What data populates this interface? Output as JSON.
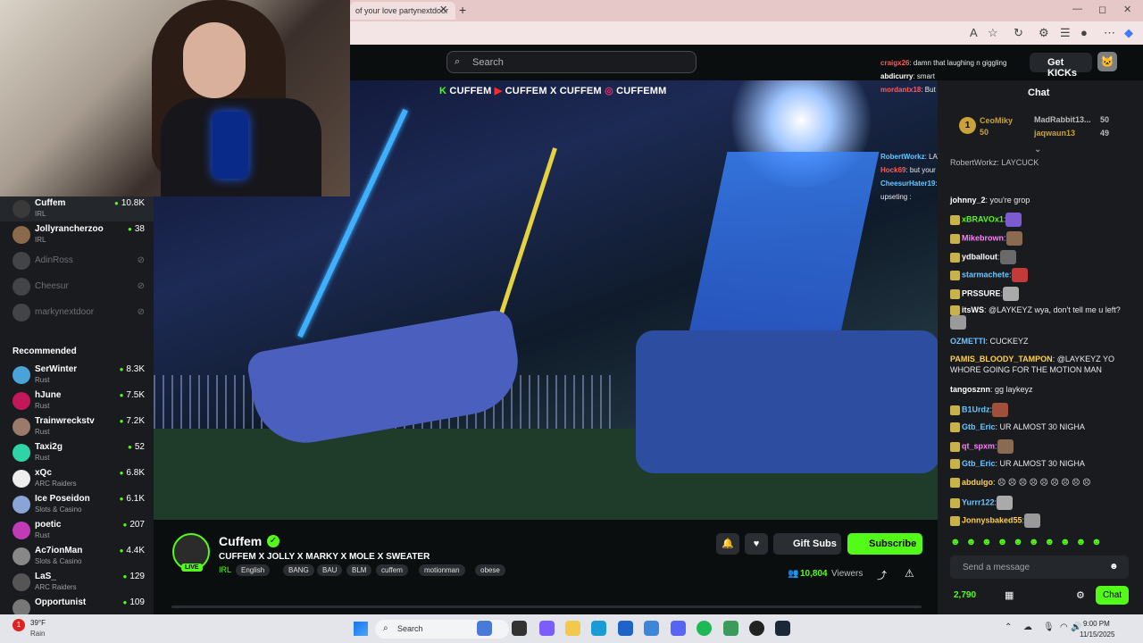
{
  "browser": {
    "tab_title": "of your love partynextdoor",
    "tab_close": "✕",
    "new_tab": "+",
    "win_min": "—",
    "win_max": "◻",
    "win_close": "✕"
  },
  "header": {
    "search_placeholder": "Search",
    "get_kicks": "Get KICKs"
  },
  "sidebar": {
    "following": [
      {
        "name": "Cuffem",
        "category": "IRL",
        "viewers": "10.8K",
        "live": true,
        "color": "#3a3a3a"
      },
      {
        "name": "Jollyrancherzoo",
        "category": "IRL",
        "viewers": "38",
        "live": true,
        "color": "#8a6a4a"
      },
      {
        "name": "AdinRoss",
        "category": "",
        "viewers": "",
        "live": false,
        "color": "#777"
      },
      {
        "name": "Cheesur",
        "category": "",
        "viewers": "",
        "live": false,
        "color": "#777"
      },
      {
        "name": "markynextdoor",
        "category": "",
        "viewers": "",
        "live": false,
        "color": "#777"
      }
    ],
    "recommended_heading": "Recommended",
    "recommended": [
      {
        "name": "SerWinter",
        "category": "Rust",
        "viewers": "8.3K",
        "color": "#4aa3d8"
      },
      {
        "name": "hJune",
        "category": "Rust",
        "viewers": "7.5K",
        "color": "#c2185b"
      },
      {
        "name": "Trainwreckstv",
        "category": "Rust",
        "viewers": "7.2K",
        "color": "#9a7a6a"
      },
      {
        "name": "Taxi2g",
        "category": "Rust",
        "viewers": "52",
        "color": "#2ed3a8"
      },
      {
        "name": "xQc",
        "category": "ARC Raiders",
        "viewers": "6.8K",
        "color": "#eee"
      },
      {
        "name": "Ice Poseidon",
        "category": "Slots & Casino",
        "viewers": "6.1K",
        "color": "#8aa4d8"
      },
      {
        "name": "poetic",
        "category": "Rust",
        "viewers": "207",
        "color": "#c13ab8"
      },
      {
        "name": "Ac7ionMan",
        "category": "Slots & Casino",
        "viewers": "4.4K",
        "color": "#888"
      },
      {
        "name": "LaS_",
        "category": "ARC Raiders",
        "viewers": "129",
        "color": "#555"
      },
      {
        "name": "Opportunist",
        "category": "",
        "viewers": "109",
        "color": "#777"
      }
    ]
  },
  "video": {
    "overlay_parts": [
      "K",
      "CUFFEM",
      "▶",
      "CUFFEM",
      "X",
      "CUFFEM",
      "◎",
      "CUFFEMM"
    ]
  },
  "overlay_chat": [
    {
      "user": "craigx26",
      "text": ": damn that laughing n giggling",
      "color": "#ff5a5a"
    },
    {
      "user": "abdicurry",
      "text": ": smart",
      "color": "#fff"
    },
    {
      "user": "mordantx18",
      "text": ": But youre aullySilly",
      "color": "#ff5a5a"
    },
    {
      "user": "RobertWorkz",
      "text": ": LAYCUCK",
      "color": "#6ac6ff"
    },
    {
      "user": "Hock69",
      "text": ": but your name is silly",
      "color": "#ff5a5a"
    },
    {
      "user": "CheesurHater19",
      "text": ": u didnt even talk in stream",
      "color": "#6ac6ff"
    },
    {
      "user": "",
      "text": "upseting :",
      "color": "#ccc"
    }
  ],
  "stream": {
    "streamer": "Cuffem",
    "title": "CUFFEM X JOLLY X MARKY X MOLE X SWEATER",
    "category": "IRL",
    "tags": [
      "English",
      "BANG",
      "BAU",
      "BLM",
      "cuffem",
      "motionman",
      "obese"
    ],
    "live": "LIVE",
    "gift_subs": "Gift Subs",
    "subscribe": "Subscribe",
    "viewers": "10,804",
    "viewers_label": "Viewers"
  },
  "chat": {
    "title": "Chat",
    "gifters": [
      {
        "rank": "1",
        "name": "CeoMiky",
        "count": "50"
      },
      {
        "name": "MadRabbit13...",
        "count": "50"
      },
      {
        "name": "jaqwaun13",
        "count": "49"
      }
    ],
    "pinned": "RobertWorkz: LAYCUCK",
    "messages": [
      {
        "user": "johnny_2",
        "text": ": you're grop",
        "color": "#ffffff"
      },
      {
        "user": "xBRAVOx1",
        "text": ":",
        "color": "#53fc18"
      },
      {
        "user": "Mikebrown",
        "text": ":",
        "color": "#ff7fff"
      },
      {
        "user": "ydballout",
        "text": ":",
        "color": "#ffffff"
      },
      {
        "user": "starmachete",
        "text": ":",
        "color": "#6ac6ff"
      },
      {
        "user": "PRSSURE",
        "text": ":",
        "color": "#ffffff"
      },
      {
        "user": "itsWS",
        "text": ": @LAYKEYZ wya, don't tell me u left?",
        "color": "#ffffff"
      },
      {
        "user": "OZMETTI",
        "text": ": CUCKEYZ",
        "color": "#6ac6ff"
      },
      {
        "user": "PAMIS_BLOODY_TAMPON",
        "text": ": @LAYKEYZ YO WHORE GOING FOR THE MOTION MAN",
        "color": "#ffd24a"
      },
      {
        "user": "tangosznn",
        "text": ": gg laykeyz",
        "color": "#ffffff"
      },
      {
        "user": "B1Urdz",
        "text": ":",
        "color": "#6ac6ff"
      },
      {
        "user": "Gtb_Eric",
        "text": ": UR ALMOST 30 NIGHA",
        "color": "#6ac6ff"
      },
      {
        "user": "qt_spxm",
        "text": ":",
        "color": "#ff7fff"
      },
      {
        "user": "Gtb_Eric",
        "text": ": UR ALMOST 30 NIGHA",
        "color": "#6ac6ff"
      },
      {
        "user": "abdulgo",
        "text": ": ☹ ☹ ☹ ☹ ☹ ☹ ☹ ☹ ☹",
        "color": "#ffd24a"
      },
      {
        "user": "Yurrr122",
        "text": ":",
        "color": "#6ac6ff"
      },
      {
        "user": "Jonnysbaked55",
        "text": ":",
        "color": "#ffd24a"
      }
    ],
    "input_placeholder": "Send a message",
    "kicks": "2,790",
    "send": "Chat"
  },
  "taskbar": {
    "temp": "39°F",
    "weather": "Rain",
    "search": "Search",
    "time": "9:00 PM",
    "date": "11/15/2025"
  },
  "colors": {
    "accent": "#53fc18",
    "bg": "#0b0e0f",
    "panel": "#191b1f"
  }
}
